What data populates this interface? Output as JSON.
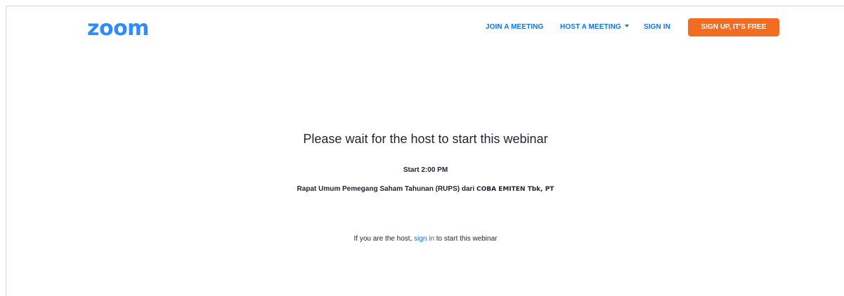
{
  "header": {
    "logo_text": "zoom",
    "nav": {
      "join_label": "JOIN A MEETING",
      "host_label": "HOST A MEETING",
      "signin_label": "SIGN IN",
      "signup_label": "SIGN UP, IT'S FREE"
    }
  },
  "main": {
    "title": "Please wait for the host to start this webinar",
    "start_time": "Start 2:00 PM",
    "topic_prefix": "Rapat Umum Pemegang Saham Tahunan (RUPS) dari",
    "topic_company": "COBA EMITEN Tbk, PT",
    "host_line": {
      "before": "If you are the host,",
      "link": "sign in",
      "after": "to start this webinar"
    }
  },
  "colors": {
    "brand_blue": "#2d8cff",
    "link_blue": "#0e72ed",
    "signup_orange": "#f26d21",
    "text_dark": "#232333"
  }
}
